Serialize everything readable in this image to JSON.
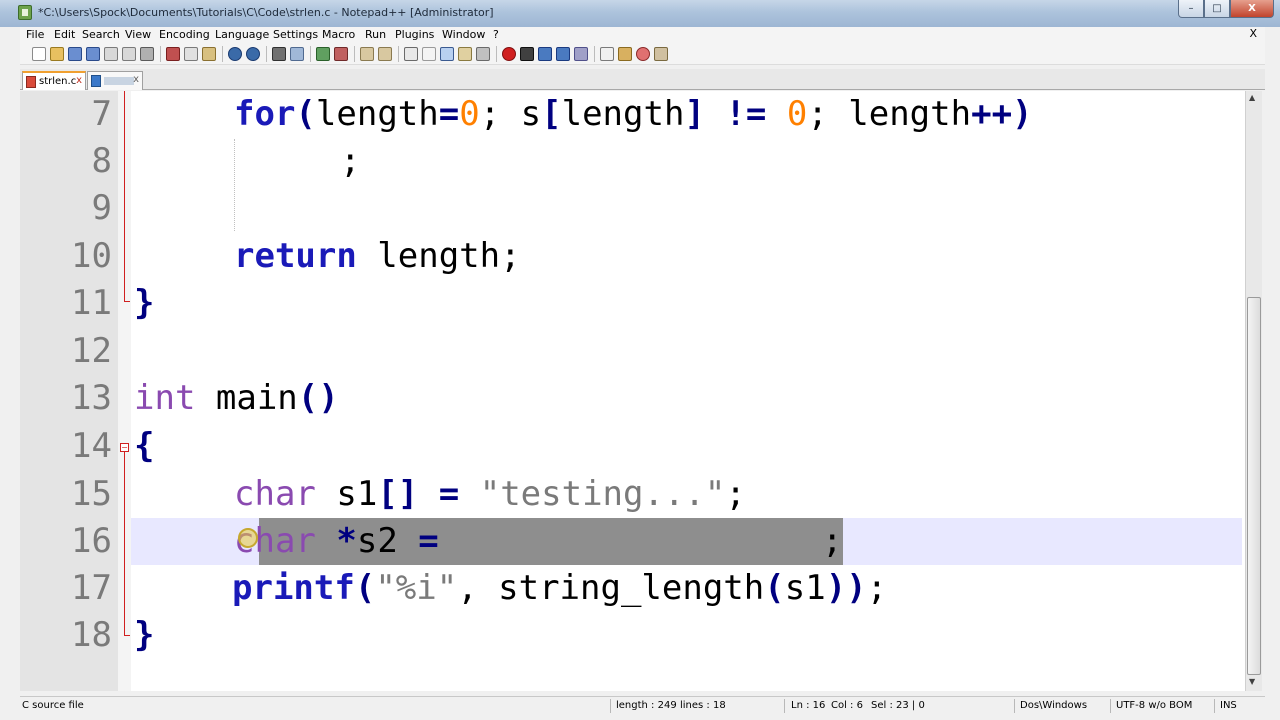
{
  "window": {
    "title": "*C:\\Users\\Spock\\Documents\\Tutorials\\C\\Code\\strlen.c - Notepad++ [Administrator]",
    "controls": [
      "–",
      "□",
      "X"
    ]
  },
  "menu": {
    "items": [
      "File",
      "Edit",
      "Search",
      "View",
      "Encoding",
      "Language",
      "Settings",
      "Macro",
      "Run",
      "Plugins",
      "Window",
      "?"
    ],
    "close": "X"
  },
  "tabs": [
    {
      "label": "strlen.c",
      "close": "x",
      "active": true
    },
    {
      "label": "",
      "close": "x",
      "active": false
    }
  ],
  "editor": {
    "lines": [
      {
        "num": "7"
      },
      {
        "num": "8"
      },
      {
        "num": "9"
      },
      {
        "num": "10"
      },
      {
        "num": "11"
      },
      {
        "num": "12"
      },
      {
        "num": "13"
      },
      {
        "num": "14"
      },
      {
        "num": "15"
      },
      {
        "num": "16"
      },
      {
        "num": "17"
      },
      {
        "num": "18"
      }
    ],
    "code": {
      "l7_kw": "for",
      "l7_a": "(",
      "l7_b": "length",
      "l7_c": "=",
      "l7_d": "0",
      "l7_e": "; s",
      "l7_f": "[",
      "l7_g": "length",
      "l7_h": "]",
      "l7_i": " ",
      "l7_j": "!=",
      "l7_k": " ",
      "l7_l": "0",
      "l7_m": "; length",
      "l7_n": "++)",
      "l8": ";",
      "l10_kw": "return",
      "l10_rest": " length;",
      "l11": "}",
      "l13_kw": "int",
      "l13_rest": " main",
      "l13_paren": "()",
      "l14": "{",
      "l15_type": "char",
      "l15_a": " s1",
      "l15_b": "[]",
      "l15_c": " ",
      "l15_d": "=",
      "l15_e": " ",
      "l15_f": "\"testing...\"",
      "l15_g": ";",
      "l16_type": "char",
      "l16_a": " ",
      "l16_b": "*",
      "l16_c": "s2",
      "l16_d": " ",
      "l16_e": "=",
      "l16_g": ";",
      "l17_kw": "printf",
      "l17_a": "(",
      "l17_b": "\"%i\"",
      "l17_c": ", string_length",
      "l17_d": "(",
      "l17_e": "s1",
      "l17_f": "))",
      "l17_g": ";",
      "l18": "}"
    }
  },
  "status": {
    "file_type": "C source file",
    "length": "length : 249",
    "lines": "lines : 18",
    "ln": "Ln : 16",
    "col": "Col : 6",
    "sel": "Sel : 23 | 0",
    "eol": "Dos\\Windows",
    "encoding": "UTF-8 w/o BOM",
    "mode": "INS"
  }
}
